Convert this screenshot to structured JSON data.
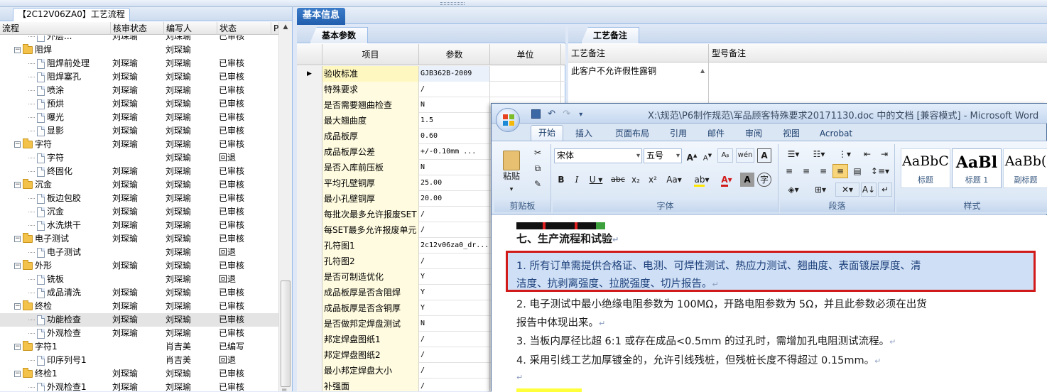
{
  "left_panel": {
    "tab_title": "【2C12V06ZA0】工艺流程",
    "columns": [
      "流程",
      "核审状态",
      "编写人",
      "状态",
      "P"
    ],
    "rows": [
      {
        "name": "外层...",
        "level": 3,
        "kind": "doc",
        "reviewer": "刘琛瑜",
        "writer": "刘琛瑜",
        "status": "已审核"
      },
      {
        "name": "阻焊",
        "level": 2,
        "kind": "folder",
        "reviewer": "",
        "writer": "刘琛瑜",
        "status": ""
      },
      {
        "name": "阻焊前处理",
        "level": 3,
        "kind": "doc",
        "reviewer": "刘琛瑜",
        "writer": "刘琛瑜",
        "status": "已审核"
      },
      {
        "name": "阻焊塞孔",
        "level": 3,
        "kind": "doc",
        "reviewer": "刘琛瑜",
        "writer": "刘琛瑜",
        "status": "已审核"
      },
      {
        "name": "喷涂",
        "level": 3,
        "kind": "doc",
        "reviewer": "刘琛瑜",
        "writer": "刘琛瑜",
        "status": "已审核"
      },
      {
        "name": "预烘",
        "level": 3,
        "kind": "doc",
        "reviewer": "刘琛瑜",
        "writer": "刘琛瑜",
        "status": "已审核"
      },
      {
        "name": "曝光",
        "level": 3,
        "kind": "doc",
        "reviewer": "刘琛瑜",
        "writer": "刘琛瑜",
        "status": "已审核"
      },
      {
        "name": "显影",
        "level": 3,
        "kind": "doc",
        "reviewer": "刘琛瑜",
        "writer": "刘琛瑜",
        "status": "已审核"
      },
      {
        "name": "字符",
        "level": 2,
        "kind": "folder",
        "reviewer": "刘琛瑜",
        "writer": "刘琛瑜",
        "status": "已审核"
      },
      {
        "name": "字符",
        "level": 3,
        "kind": "doc",
        "reviewer": "",
        "writer": "刘琛瑜",
        "status": "回退"
      },
      {
        "name": "终固化",
        "level": 3,
        "kind": "doc",
        "reviewer": "刘琛瑜",
        "writer": "刘琛瑜",
        "status": "已审核"
      },
      {
        "name": "沉金",
        "level": 2,
        "kind": "folder",
        "reviewer": "刘琛瑜",
        "writer": "刘琛瑜",
        "status": "已审核"
      },
      {
        "name": "板边包胶",
        "level": 3,
        "kind": "doc",
        "reviewer": "刘琛瑜",
        "writer": "刘琛瑜",
        "status": "已审核"
      },
      {
        "name": "沉金",
        "level": 3,
        "kind": "doc",
        "reviewer": "刘琛瑜",
        "writer": "刘琛瑜",
        "status": "已审核"
      },
      {
        "name": "水洗烘干",
        "level": 3,
        "kind": "doc",
        "reviewer": "刘琛瑜",
        "writer": "刘琛瑜",
        "status": "已审核"
      },
      {
        "name": "电子测试",
        "level": 2,
        "kind": "folder",
        "reviewer": "刘琛瑜",
        "writer": "刘琛瑜",
        "status": "已审核"
      },
      {
        "name": "电子测试",
        "level": 3,
        "kind": "doc",
        "reviewer": "",
        "writer": "刘琛瑜",
        "status": "回退"
      },
      {
        "name": "外形",
        "level": 2,
        "kind": "folder",
        "reviewer": "刘琛瑜",
        "writer": "刘琛瑜",
        "status": "已审核"
      },
      {
        "name": "铣板",
        "level": 3,
        "kind": "doc",
        "reviewer": "",
        "writer": "刘琛瑜",
        "status": "回退"
      },
      {
        "name": "成品清洗",
        "level": 3,
        "kind": "doc",
        "reviewer": "刘琛瑜",
        "writer": "刘琛瑜",
        "status": "已审核"
      },
      {
        "name": "终检",
        "level": 2,
        "kind": "folder",
        "reviewer": "刘琛瑜",
        "writer": "刘琛瑜",
        "status": "已审核"
      },
      {
        "name": "功能检查",
        "level": 3,
        "kind": "doc",
        "reviewer": "刘琛瑜",
        "writer": "刘琛瑜",
        "status": "已审核",
        "selected": true
      },
      {
        "name": "外观检查",
        "level": 3,
        "kind": "doc",
        "reviewer": "刘琛瑜",
        "writer": "刘琛瑜",
        "status": "已审核"
      },
      {
        "name": "字符1",
        "level": 2,
        "kind": "folder",
        "reviewer": "",
        "writer": "肖吉美",
        "status": "已编写"
      },
      {
        "name": "印序列号1",
        "level": 3,
        "kind": "doc",
        "reviewer": "",
        "writer": "肖吉美",
        "status": "回退"
      },
      {
        "name": "终检1",
        "level": 2,
        "kind": "folder",
        "reviewer": "刘琛瑜",
        "writer": "刘琛瑜",
        "status": "已审核"
      },
      {
        "name": "外观检查1",
        "level": 3,
        "kind": "doc",
        "reviewer": "刘琛瑜",
        "writer": "刘琛瑜",
        "status": "已审核"
      }
    ]
  },
  "main": {
    "tab_title": "基本信息",
    "params": {
      "tab_title": "基本参数",
      "columns": [
        "项目",
        "参数",
        "单位"
      ],
      "rows": [
        {
          "item": "验收标准",
          "value": "GJB362B-2009",
          "current": true
        },
        {
          "item": "特殊要求",
          "value": "/"
        },
        {
          "item": "是否需要翘曲检查",
          "value": "N"
        },
        {
          "item": "最大翘曲度",
          "value": "1.5"
        },
        {
          "item": "成品板厚",
          "value": "0.60"
        },
        {
          "item": "成品板厚公差",
          "value": "+/-0.10mm    ..."
        },
        {
          "item": "是否入库前压板",
          "value": "N"
        },
        {
          "item": "平均孔壁铜厚",
          "value": "25.00"
        },
        {
          "item": "最小孔壁铜厚",
          "value": "20.00"
        },
        {
          "item": "每批次最多允许报废SET",
          "value": "/"
        },
        {
          "item": "每SET最多允许报废单元",
          "value": "/"
        },
        {
          "item": "孔符图1",
          "value": "2c12v06za0_dr..."
        },
        {
          "item": "孔符图2",
          "value": "/"
        },
        {
          "item": "是否可制造优化",
          "value": "Y"
        },
        {
          "item": "成品板厚是否含阻焊",
          "value": "Y"
        },
        {
          "item": "成品板厚是否含铜厚",
          "value": "Y"
        },
        {
          "item": "是否做邦定焊盘测试",
          "value": "N"
        },
        {
          "item": "邦定焊盘图纸1",
          "value": "/"
        },
        {
          "item": "邦定焊盘图纸2",
          "value": "/"
        },
        {
          "item": "最小邦定焊盘大小",
          "value": "/"
        },
        {
          "item": "补强面",
          "value": "/"
        }
      ]
    },
    "notes": {
      "tab_title": "工艺备注",
      "col_process_note": "工艺备注",
      "col_model_note": "型号备注",
      "process_note_value": "此客户不允许假性露铜"
    }
  },
  "word": {
    "title": "X:\\规范\\P6制作规范\\军品顾客特殊要求20171130.doc 中的文档 [兼容模式] - Microsoft Word",
    "tabs": [
      "开始",
      "插入",
      "页面布局",
      "引用",
      "邮件",
      "审阅",
      "视图",
      "Acrobat"
    ],
    "active_tab": "开始",
    "groups": {
      "clipboard": "剪贴板",
      "font": "字体",
      "paragraph": "段落",
      "styles": "样式"
    },
    "paste_label": "粘贴",
    "font_name": "宋体",
    "font_size": "五号",
    "styles": [
      {
        "preview": "AaBbC",
        "name": "标题"
      },
      {
        "preview": "AaBl",
        "name": "标题 1"
      },
      {
        "preview": "AaBb(",
        "name": "副标题"
      }
    ],
    "doc": {
      "heading": "七、生产流程和试验",
      "para1_line1": "1. 所有订单需提供合格证、电测、可焊性测试、热应力测试、翘曲度、表面镀层厚度、清",
      "para1_line2": "洁度、抗剥离强度、拉脱强度、切片报告。",
      "para2_line1": "2. 电子测试中最小绝缘电阻参数为 100MΩ，开路电阻参数为 5Ω，并且此参数必须在出货",
      "para2_line2": "报告中体现出来。",
      "para3": "3. 当板内厚径比超 6:1 或存在成品<0.5mm 的过孔时，需增加孔电阻测试流程。",
      "para4": "4. 采用引线工艺加厚镀金的，允许引线残桩，但残桩长度不得超过 0.15mm。"
    },
    "accent": "#d11a1a"
  }
}
